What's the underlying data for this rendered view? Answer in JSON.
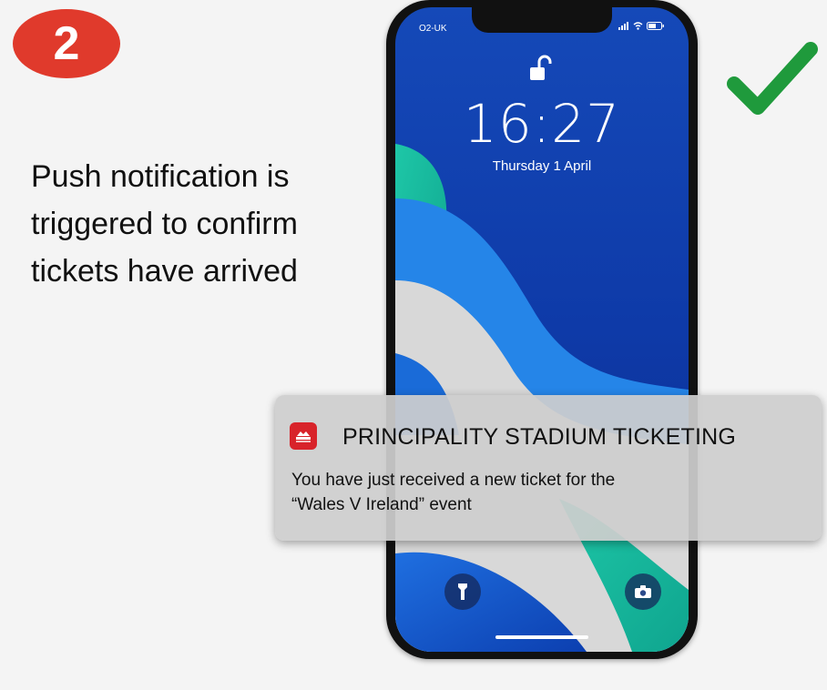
{
  "step": {
    "number": "2"
  },
  "description": {
    "lines": [
      "Push notification is",
      "triggered to confirm",
      "tickets have arrived"
    ]
  },
  "colors": {
    "badge": "#e03a2c",
    "check": "#1f9a3c",
    "app_icon": "#d8232a"
  },
  "phone": {
    "carrier": "O2-UK",
    "time": "16:27",
    "date": "Thursday 1 April",
    "icons": [
      "unlocked-padlock-icon",
      "signal-icon",
      "wifi-icon",
      "battery-icon",
      "flashlight-icon",
      "camera-icon"
    ]
  },
  "notification": {
    "app_name": "PRINCIPALITY STADIUM TICKETING",
    "message_line1": "You have just received a new ticket for the",
    "message_line2": "“Wales V Ireland” event"
  }
}
